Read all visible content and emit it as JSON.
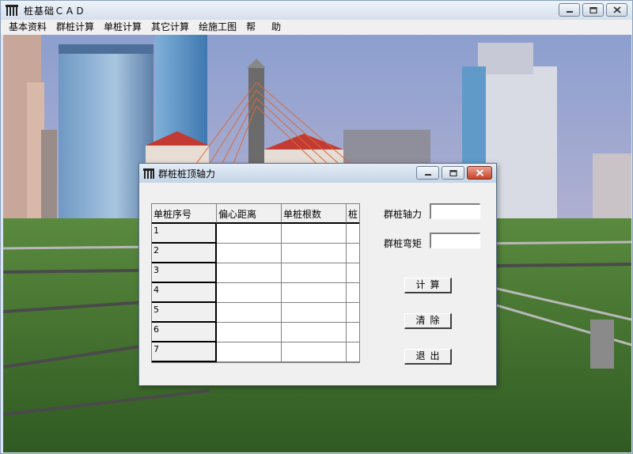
{
  "app": {
    "title": "桩基础ＣＡＤ",
    "menu": [
      "基本资料",
      "群桩计算",
      "单桩计算",
      "其它计算",
      "绘施工图",
      "帮",
      "助"
    ]
  },
  "dialog": {
    "title": "群桩桩顶轴力",
    "table": {
      "headers": [
        "单桩序号",
        "偏心距离",
        "单桩根数",
        "桩"
      ],
      "rows": [
        "1",
        "2",
        "3",
        "4",
        "5",
        "6",
        "7"
      ]
    },
    "fields": {
      "axial_force_label": "群桩轴力",
      "axial_force_value": "",
      "moment_label": "群桩弯矩",
      "moment_value": ""
    },
    "buttons": {
      "calculate": "计算",
      "clear": "清除",
      "exit": "退出"
    }
  },
  "colors": {
    "sky_top": "#8c9fcf",
    "sky_bottom": "#c9b7c9",
    "grass": "#3f6a2c",
    "close_button": "#c7442a"
  },
  "icons": [
    "app-icon",
    "minimize-icon",
    "maximize-icon",
    "close-icon"
  ]
}
